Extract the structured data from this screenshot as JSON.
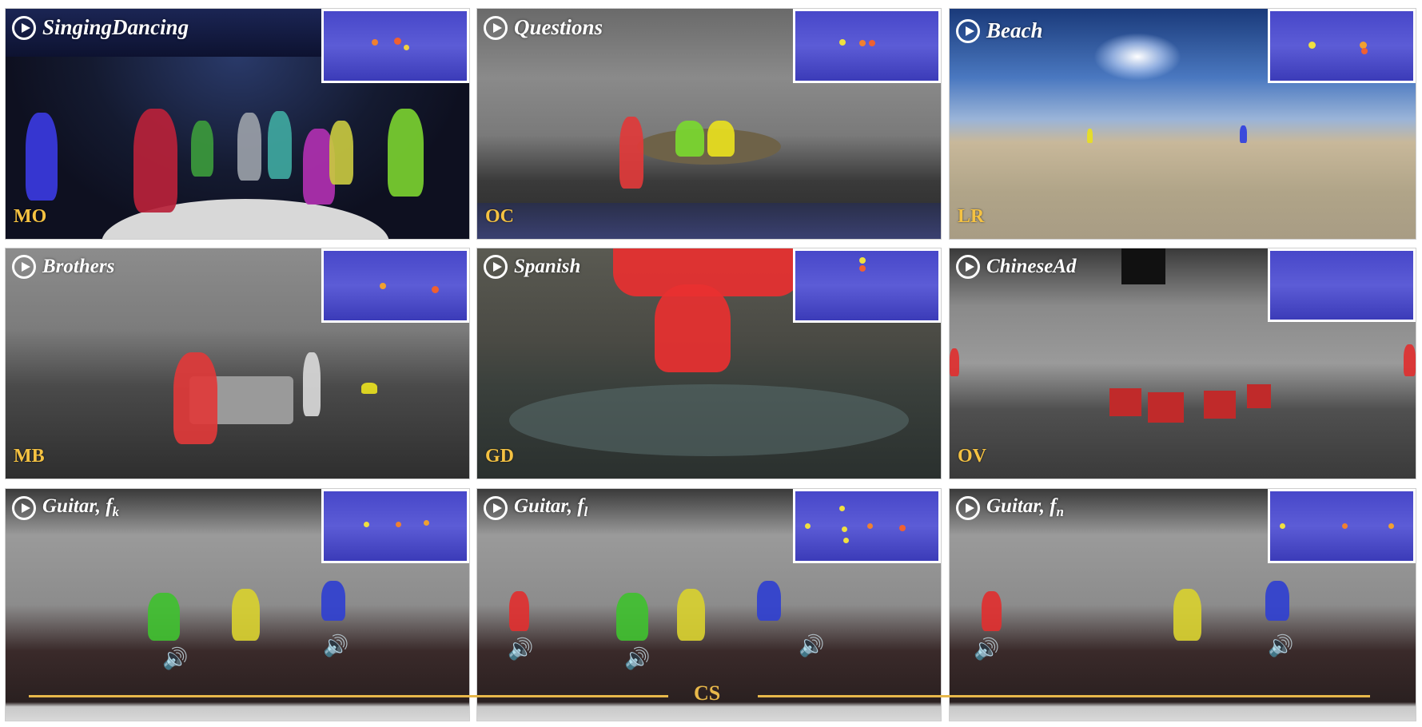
{
  "panels": [
    {
      "title": "SingingDancing",
      "badge": "MO"
    },
    {
      "title": "Questions",
      "badge": "OC"
    },
    {
      "title": "Beach",
      "badge": "LR"
    },
    {
      "title": "Brothers",
      "badge": "MB"
    },
    {
      "title": "Spanish",
      "badge": "GD"
    },
    {
      "title": "ChineseAd",
      "badge": "OV"
    },
    {
      "title": "Guitar, f",
      "sub": "k",
      "badge": ""
    },
    {
      "title": "Guitar, f",
      "sub": "l",
      "badge": ""
    },
    {
      "title": "Guitar, f",
      "sub": "n",
      "badge": ""
    }
  ],
  "bottom_label": "CS",
  "colors": {
    "accent": "#f5c242",
    "cs_line": "#e8b84a",
    "inset_blue": "#4a4ad0"
  },
  "icons": [
    "play-icon",
    "speaker-icon"
  ]
}
